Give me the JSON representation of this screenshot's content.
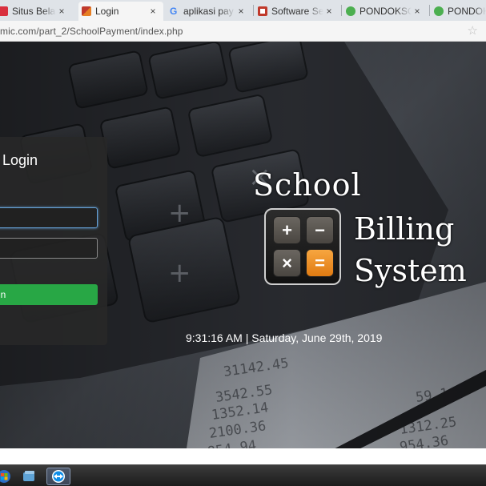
{
  "browser": {
    "tabs": [
      {
        "label": "Situs Belanja",
        "favicon_color": "#d9303e",
        "active": false
      },
      {
        "label": "Login",
        "favicon_color": "#c0392b",
        "active": true
      },
      {
        "label": "aplikasi pay",
        "favicon_color": "#4285f4",
        "active": false
      },
      {
        "label": "Software Se",
        "favicon_color": "#c0392b",
        "active": false
      },
      {
        "label": "PONDOKSO",
        "favicon_color": "#4caf50",
        "active": false
      },
      {
        "label": "PONDOKS",
        "favicon_color": "#4caf50",
        "active": false
      }
    ],
    "close_glyph": "×",
    "url": "mic.com/part_2/SchoolPayment/index.php",
    "bookmark_icon": "star-icon"
  },
  "login": {
    "title": "Login",
    "username_value": "",
    "password_value": "",
    "button_label": "in"
  },
  "logo": {
    "line1": "School",
    "line2": "Billing",
    "line3": "System",
    "keys": [
      "+",
      "−",
      "×",
      "="
    ]
  },
  "clock": {
    "text": "9:31:16 AM | Saturday, June 29th, 2019"
  },
  "colors": {
    "accent_green": "#28a745",
    "focus_blue": "#66a3d9",
    "key_orange": "#e07b12"
  },
  "taskbar": {
    "icons": [
      "start-orb-icon",
      "wallet-icon",
      "teamviewer-icon"
    ]
  }
}
